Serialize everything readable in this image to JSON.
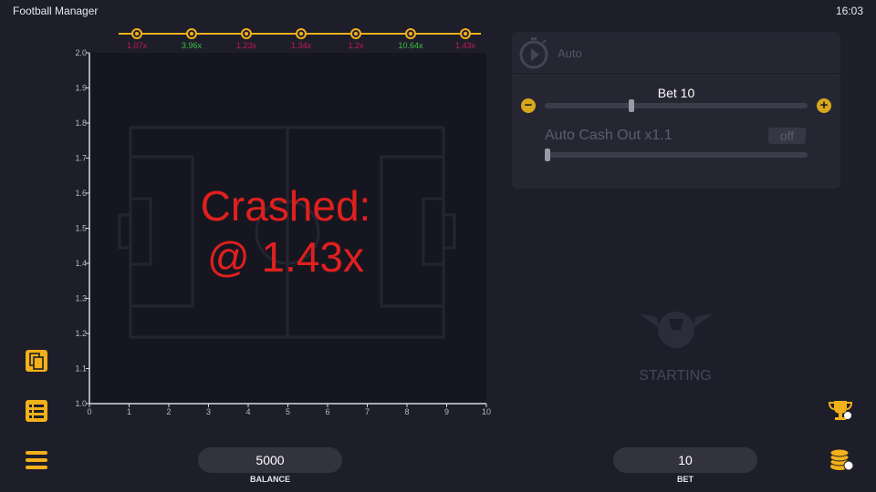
{
  "app": {
    "title": "Football Manager",
    "time": "16:03"
  },
  "history": [
    {
      "value": "1.07x",
      "color": "#c2185b"
    },
    {
      "value": "3.96x",
      "color": "#3ec23e"
    },
    {
      "value": "1.23x",
      "color": "#c2185b"
    },
    {
      "value": "1.34x",
      "color": "#c2185b"
    },
    {
      "value": "1.2x",
      "color": "#c2185b"
    },
    {
      "value": "10.64x",
      "color": "#3ec23e"
    },
    {
      "value": "1.43x",
      "color": "#c2185b"
    }
  ],
  "chart_data": {
    "type": "line",
    "x_ticks": [
      "0",
      "1",
      "2",
      "3",
      "4",
      "5",
      "6",
      "7",
      "8",
      "9",
      "10"
    ],
    "y_ticks": [
      "1.0",
      "1.1",
      "1.2",
      "1.3",
      "1.4",
      "1.5",
      "1.6",
      "1.7",
      "1.8",
      "1.9",
      "2.0"
    ],
    "xlim": [
      0,
      10
    ],
    "ylim": [
      1.0,
      2.0
    ],
    "series": [],
    "grid": false
  },
  "crash": {
    "line1": "Crashed:",
    "line2": "@ 1.43x"
  },
  "auto_panel": {
    "mode_label": "Auto",
    "bet_label": "Bet 10",
    "bet_fraction": 0.33,
    "cashout_label": "Auto Cash Out x1.1",
    "cashout_toggle": "off",
    "cashout_fraction": 0.0
  },
  "status": {
    "starting": "STARTING"
  },
  "balance": {
    "value": "5000",
    "label": "BALANCE"
  },
  "bet": {
    "value": "10",
    "label": "BET"
  },
  "colors": {
    "accent": "#f2b019",
    "crash": "#e0201e",
    "win": "#3ec23e",
    "loss": "#c2185b"
  }
}
